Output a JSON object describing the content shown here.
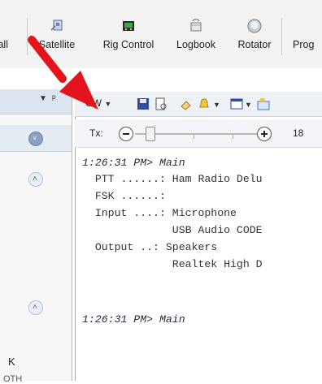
{
  "ribbon": {
    "items": [
      {
        "label": "fall",
        "icon": "waterfall-icon"
      },
      {
        "label": "Satellite",
        "icon": "satellite-icon"
      },
      {
        "label": "Rig Control",
        "icon": "rig-control-icon"
      },
      {
        "label": "Logbook",
        "icon": "logbook-icon"
      },
      {
        "label": "Rotator",
        "icon": "rotator-icon"
      },
      {
        "label": "Prog",
        "icon": "program-icon"
      }
    ]
  },
  "left_pane": {
    "pin_icon": "pin-icon",
    "dropdown_icon": "chevron-down-icon",
    "letter_k": "K",
    "cut_text": "OTH"
  },
  "toolbar": {
    "mode_label": "CW",
    "tx_label": "Tx:",
    "tx_value": "18",
    "tx_slider_fraction": 0.12
  },
  "log": {
    "lines": [
      {
        "text": "1:26:31 PM> Main",
        "style": "italic"
      },
      {
        "text": "  PTT ......: Ham Radio Delu",
        "style": "normal"
      },
      {
        "text": "  FSK ......:",
        "style": "normal"
      },
      {
        "text": "  Input ....: Microphone",
        "style": "normal"
      },
      {
        "text": "              USB Audio CODE",
        "style": "normal"
      },
      {
        "text": "  Output ..: Speakers",
        "style": "normal"
      },
      {
        "text": "              Realtek High D",
        "style": "normal"
      },
      {
        "text": "1:26:31 PM> Main",
        "style": "italic"
      }
    ]
  },
  "colors": {
    "arrow": "#e3141b",
    "accent": "#3b6fb6"
  }
}
